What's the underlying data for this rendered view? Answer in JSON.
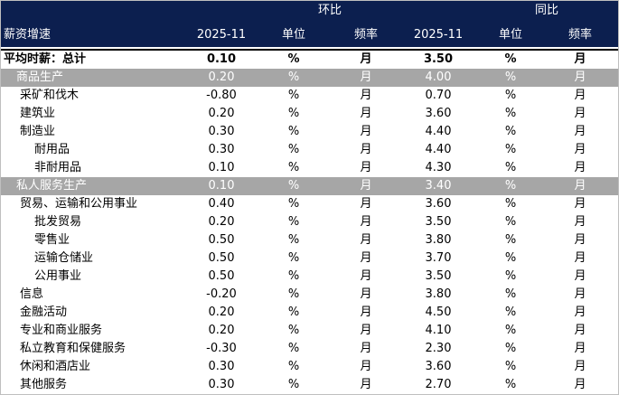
{
  "header": {
    "group_mom": "环比",
    "group_yoy": "同比",
    "col_label": "薪资增速",
    "col_period1": "2025-11",
    "col_unit1": "单位",
    "col_freq1": "频率",
    "col_period2": "2025-11",
    "col_unit2": "单位",
    "col_freq2": "频率"
  },
  "rows": [
    {
      "label": "平均时薪：总计",
      "mom": "0.10",
      "unit1": "%",
      "freq1": "月",
      "yoy": "3.50",
      "unit2": "%",
      "freq2": "月",
      "style": "bold"
    },
    {
      "label": "商品生产",
      "mom": "0.20",
      "unit1": "%",
      "freq1": "月",
      "yoy": "4.00",
      "unit2": "%",
      "freq2": "月",
      "style": "gray"
    },
    {
      "label": "采矿和伐木",
      "mom": "-0.80",
      "unit1": "%",
      "freq1": "月",
      "yoy": "0.70",
      "unit2": "%",
      "freq2": "月",
      "indent": 1
    },
    {
      "label": "建筑业",
      "mom": "0.20",
      "unit1": "%",
      "freq1": "月",
      "yoy": "3.60",
      "unit2": "%",
      "freq2": "月",
      "indent": 1
    },
    {
      "label": "制造业",
      "mom": "0.30",
      "unit1": "%",
      "freq1": "月",
      "yoy": "4.40",
      "unit2": "%",
      "freq2": "月",
      "indent": 1
    },
    {
      "label": "耐用品",
      "mom": "0.30",
      "unit1": "%",
      "freq1": "月",
      "yoy": "4.40",
      "unit2": "%",
      "freq2": "月",
      "indent": 2
    },
    {
      "label": "非耐用品",
      "mom": "0.10",
      "unit1": "%",
      "freq1": "月",
      "yoy": "4.30",
      "unit2": "%",
      "freq2": "月",
      "indent": 2
    },
    {
      "label": "私人服务生产",
      "mom": "0.10",
      "unit1": "%",
      "freq1": "月",
      "yoy": "3.40",
      "unit2": "%",
      "freq2": "月",
      "style": "gray"
    },
    {
      "label": "贸易、运输和公用事业",
      "mom": "0.40",
      "unit1": "%",
      "freq1": "月",
      "yoy": "3.60",
      "unit2": "%",
      "freq2": "月",
      "indent": 1
    },
    {
      "label": "批发贸易",
      "mom": "0.20",
      "unit1": "%",
      "freq1": "月",
      "yoy": "3.50",
      "unit2": "%",
      "freq2": "月",
      "indent": 2
    },
    {
      "label": "零售业",
      "mom": "0.50",
      "unit1": "%",
      "freq1": "月",
      "yoy": "3.80",
      "unit2": "%",
      "freq2": "月",
      "indent": 2
    },
    {
      "label": "运输仓储业",
      "mom": "0.50",
      "unit1": "%",
      "freq1": "月",
      "yoy": "3.70",
      "unit2": "%",
      "freq2": "月",
      "indent": 2
    },
    {
      "label": "公用事业",
      "mom": "0.50",
      "unit1": "%",
      "freq1": "月",
      "yoy": "3.50",
      "unit2": "%",
      "freq2": "月",
      "indent": 2
    },
    {
      "label": "信息",
      "mom": "-0.20",
      "unit1": "%",
      "freq1": "月",
      "yoy": "3.80",
      "unit2": "%",
      "freq2": "月",
      "indent": 1
    },
    {
      "label": "金融活动",
      "mom": "0.20",
      "unit1": "%",
      "freq1": "月",
      "yoy": "4.50",
      "unit2": "%",
      "freq2": "月",
      "indent": 1
    },
    {
      "label": "专业和商业服务",
      "mom": "0.20",
      "unit1": "%",
      "freq1": "月",
      "yoy": "4.10",
      "unit2": "%",
      "freq2": "月",
      "indent": 1
    },
    {
      "label": "私立教育和保健服务",
      "mom": "-0.30",
      "unit1": "%",
      "freq1": "月",
      "yoy": "2.30",
      "unit2": "%",
      "freq2": "月",
      "indent": 1
    },
    {
      "label": "休闲和酒店业",
      "mom": "0.30",
      "unit1": "%",
      "freq1": "月",
      "yoy": "3.60",
      "unit2": "%",
      "freq2": "月",
      "indent": 1
    },
    {
      "label": "其他服务",
      "mom": "0.30",
      "unit1": "%",
      "freq1": "月",
      "yoy": "2.70",
      "unit2": "%",
      "freq2": "月",
      "indent": 1
    }
  ],
  "colors": {
    "header_bg": "#0c1f4f",
    "section_bg": "#a6a6a6"
  }
}
